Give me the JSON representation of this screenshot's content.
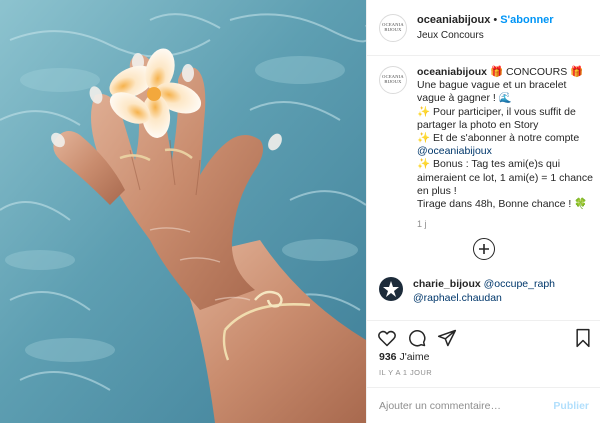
{
  "header": {
    "avatar_logo": [
      "OCEANIA",
      "BIJOUX"
    ],
    "username": "oceaniabijoux",
    "separator": "•",
    "follow_label": "S'abonner",
    "location": "Jeux Concours"
  },
  "caption": {
    "username": "oceaniabijoux",
    "title": "CONCOURS",
    "gift_icon": "gift-emoji",
    "lines": [
      "Une bague vague et un bracelet",
      "vague à gagner ! 🌊",
      "Pour participer, il vous suffit de",
      "partager la photo en Story",
      "Et de s'abonner à notre compte",
      "@oceaniabijoux",
      "Bonus : Tag tes ami(e)s qui",
      "aimeraient ce lot, 1 ami(e) = 1 chance",
      "en plus !",
      "Tirage dans 48h, Bonne chance ! 🍀"
    ],
    "sparkle": "✨",
    "age": "1 j"
  },
  "load_more_icon": "plus-circle-icon",
  "comment": {
    "username": "charie_bijoux",
    "mention1": "@occupe_raph",
    "mention2": "@raphael.chaudan"
  },
  "actions": {
    "icons": [
      "heart-icon",
      "comment-icon",
      "share-icon",
      "bookmark-icon"
    ],
    "likes_count": "936",
    "likes_label": "J'aime",
    "date": "IL Y A 1 JOUR"
  },
  "add_comment": {
    "placeholder": "Ajouter un commentaire…",
    "publish_label": "Publier"
  },
  "colors": {
    "link_blue": "#0095f6",
    "mention_blue": "#00376b",
    "publish_disabled": "#b2dffc",
    "water": "#5d9cb0"
  }
}
